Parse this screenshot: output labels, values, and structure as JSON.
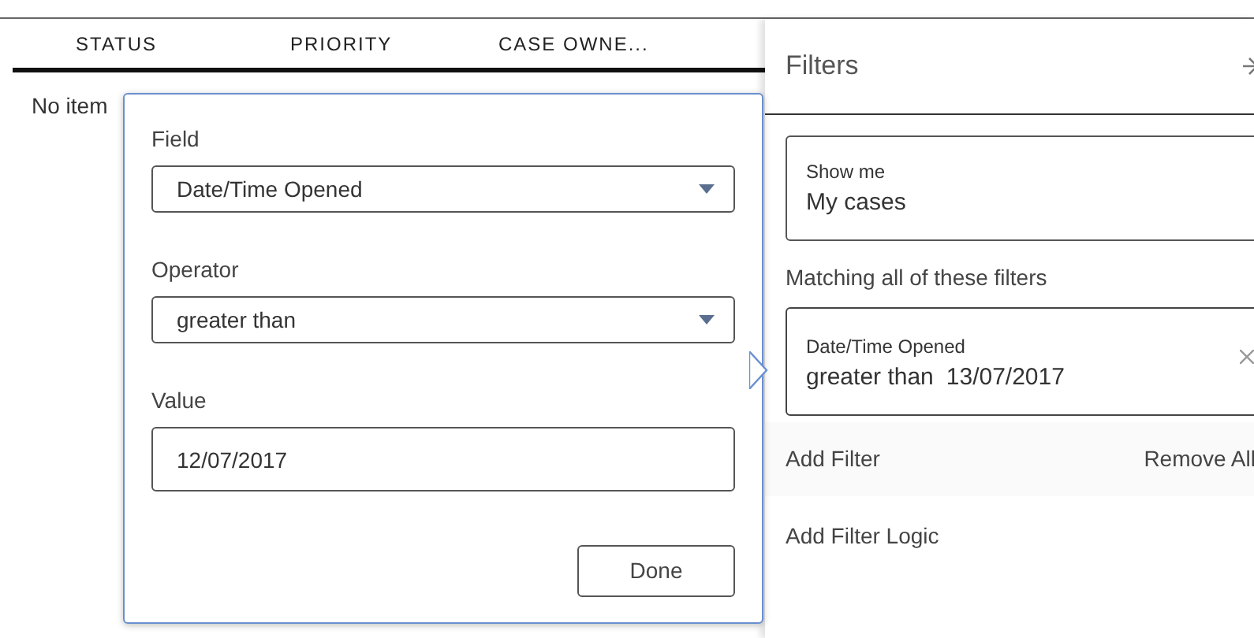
{
  "table": {
    "columns": [
      "STATUS",
      "PRIORITY",
      "CASE OWNE..."
    ],
    "empty_text": "No item"
  },
  "filter_editor": {
    "fields": [
      {
        "kind": "select",
        "label": "Field",
        "value": "Date/Time Opened"
      },
      {
        "kind": "select",
        "label": "Operator",
        "value": "greater than"
      },
      {
        "kind": "input",
        "label": "Value",
        "value": "12/07/2017"
      }
    ],
    "done_button": "Done"
  },
  "filters_panel": {
    "title": "Filters",
    "show_me": {
      "label": "Show me",
      "value": "My cases"
    },
    "matching_label": "Matching all of these filters",
    "filters": [
      {
        "field": "Date/Time Opened",
        "operator": "greater than",
        "value": "13/07/2017",
        "selected": true
      }
    ],
    "add_filter": "Add Filter",
    "remove_all": "Remove All",
    "add_filter_logic": "Add Filter Logic"
  }
}
